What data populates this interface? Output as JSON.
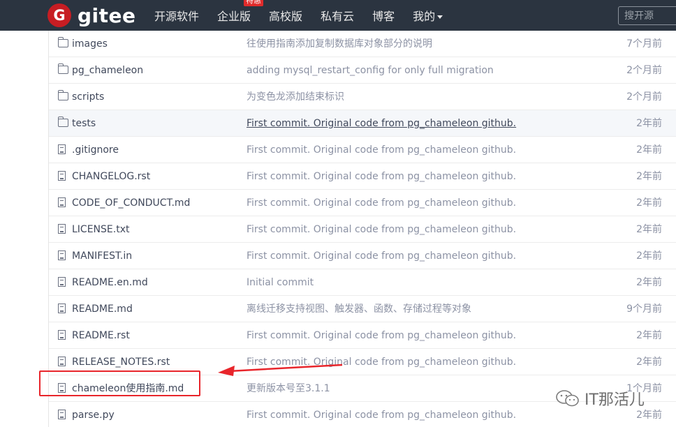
{
  "header": {
    "logo_letter": "G",
    "logo_text": "gitee",
    "nav": [
      {
        "label": "开源软件",
        "badge": null
      },
      {
        "label": "企业版",
        "badge": "特惠"
      },
      {
        "label": "高校版",
        "badge": null
      },
      {
        "label": "私有云",
        "badge": null
      },
      {
        "label": "博客",
        "badge": null
      },
      {
        "label": "我的",
        "badge": null
      }
    ],
    "search_placeholder": "搜开源"
  },
  "files": [
    {
      "type": "folder",
      "name": "images",
      "message": "往使用指南添加复制数据库对象部分的说明",
      "time": "7个月前"
    },
    {
      "type": "folder",
      "name": "pg_chameleon",
      "message": "adding mysql_restart_config for only full migration",
      "time": "2个月前"
    },
    {
      "type": "folder",
      "name": "scripts",
      "message": "为变色龙添加结束标识",
      "time": "2个月前"
    },
    {
      "type": "folder",
      "name": "tests",
      "message": "First commit. Original code from pg_chameleon github.",
      "time": "2年前"
    },
    {
      "type": "file",
      "name": ".gitignore",
      "message": "First commit. Original code from pg_chameleon github.",
      "time": "2年前"
    },
    {
      "type": "file",
      "name": "CHANGELOG.rst",
      "message": "First commit. Original code from pg_chameleon github.",
      "time": "2年前"
    },
    {
      "type": "file",
      "name": "CODE_OF_CONDUCT.md",
      "message": "First commit. Original code from pg_chameleon github.",
      "time": "2年前"
    },
    {
      "type": "file",
      "name": "LICENSE.txt",
      "message": "First commit. Original code from pg_chameleon github.",
      "time": "2年前"
    },
    {
      "type": "file",
      "name": "MANIFEST.in",
      "message": "First commit. Original code from pg_chameleon github.",
      "time": "2年前"
    },
    {
      "type": "file",
      "name": "README.en.md",
      "message": "Initial commit",
      "time": "2年前"
    },
    {
      "type": "file",
      "name": "README.md",
      "message": "离线迁移支持视图、触发器、函数、存储过程等对象",
      "time": "9个月前"
    },
    {
      "type": "file",
      "name": "README.rst",
      "message": "First commit. Original code from pg_chameleon github.",
      "time": "2年前"
    },
    {
      "type": "file",
      "name": "RELEASE_NOTES.rst",
      "message": "First commit. Original code from pg_chameleon github.",
      "time": "2年前"
    },
    {
      "type": "file",
      "name": "chameleon使用指南.md",
      "message": "更新版本号至3.1.1",
      "time": "1个月前"
    },
    {
      "type": "file",
      "name": "parse.py",
      "message": "First commit. Original code from pg_chameleon github.",
      "time": "2年前"
    }
  ],
  "watermark": "IT那活儿",
  "colors": {
    "header_bg": "#2b3440",
    "logo_red": "#c71d23",
    "annotation_red": "#e8252b",
    "link": "#40485b",
    "muted": "#8c92a4"
  }
}
